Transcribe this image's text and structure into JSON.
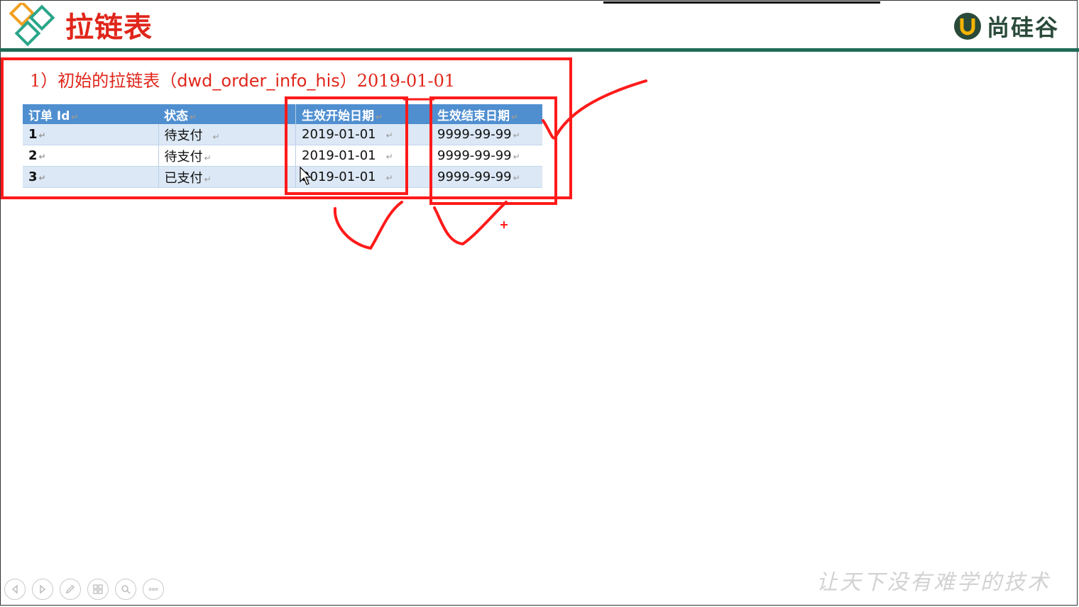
{
  "slide": {
    "title": "拉链表",
    "brand_name": "尚硅谷",
    "subtitle_prefix": "1）初始的拉链表（",
    "subtitle_code": "dwd_order_info_his",
    "subtitle_suffix": "）2019-01-01",
    "watermark": "让天下没有难学的技术"
  },
  "colors": {
    "accent_red": "#e0261b",
    "header_rule": "#1e6b57",
    "table_header": "#4f8fd0",
    "row_stripe": "#dce8f5"
  },
  "table": {
    "headers": [
      "订单 Id",
      "状态",
      "生效开始日期",
      "生效结束日期"
    ],
    "rows": [
      [
        "1",
        "待支付",
        "2019-01-01",
        "9999-99-99"
      ],
      [
        "2",
        "待支付",
        "2019-01-01",
        "9999-99-99"
      ],
      [
        "3",
        "已支付",
        "2019-01-01",
        "9999-99-99"
      ]
    ]
  },
  "toolbar": {
    "buttons": [
      "previous-icon",
      "next-icon",
      "pen-icon",
      "slides-icon",
      "zoom-icon",
      "more-icon"
    ]
  }
}
